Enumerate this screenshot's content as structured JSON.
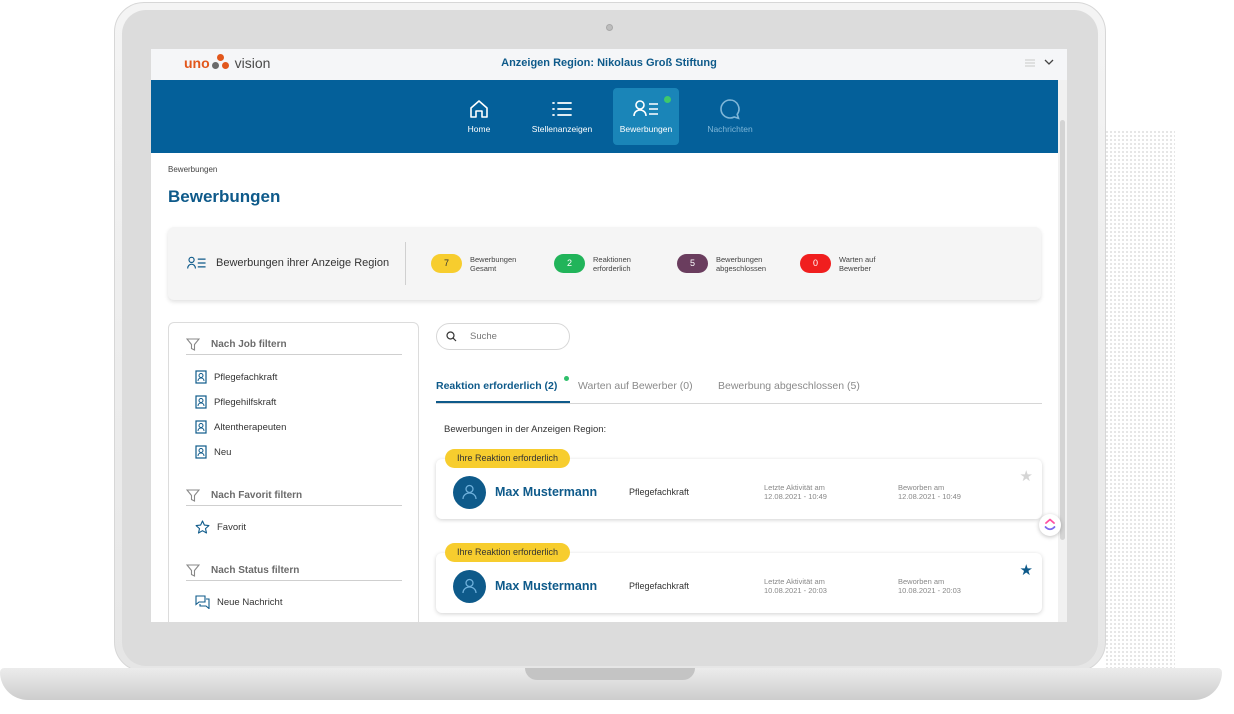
{
  "logo": {
    "part1": "uno",
    "part2": "vision"
  },
  "app_title": "Anzeigen Region: Nikolaus Groß Stiftung",
  "nav": {
    "home": "Home",
    "stellenanzeigen": "Stellenanzeigen",
    "bewerbungen": "Bewerbungen",
    "nachrichten": "Nachrichten"
  },
  "breadcrumb": "Bewerbungen",
  "page_title": "Bewerbungen",
  "stats": {
    "label": "Bewerbungen ihrer Anzeige Region",
    "items": [
      {
        "count": "7",
        "line1": "Bewerbungen",
        "line2": "Gesamt",
        "color": "#f7cd2e"
      },
      {
        "count": "2",
        "line1": "Reaktionen",
        "line2": "erforderlich",
        "color": "#21b45a"
      },
      {
        "count": "5",
        "line1": "Bewerbungen",
        "line2": "abgeschlossen",
        "color": "#6a3d5e"
      },
      {
        "count": "0",
        "line1": "Warten auf",
        "line2": "Bewerber",
        "color": "#f01e1e"
      }
    ]
  },
  "filters": {
    "job_heading": "Nach Job filtern",
    "jobs": [
      "Pflegefachkraft",
      "Pflegehilfskraft",
      "Altentherapeuten",
      "Neu"
    ],
    "favorit_heading": "Nach Favorit filtern",
    "favorit_item": "Favorit",
    "status_heading": "Nach Status filtern",
    "status_item": "Neue Nachricht"
  },
  "search": {
    "placeholder": "Suche"
  },
  "tabs": {
    "active": "Reaktion erforderlich (2)",
    "waiting": "Warten auf Bewerber (0)",
    "done": "Bewerbung abgeschlossen (5)"
  },
  "list_caption": "Bewerbungen in der Anzeigen Region:",
  "applications": [
    {
      "tag": "Ihre Reaktion erforderlich",
      "name": "Max Mustermann",
      "job": "Pflegefachkraft",
      "activity_label": "Letzte Aktivität am",
      "activity_date": "12.08.2021 - 10:49",
      "applied_label": "Beworben am",
      "applied_date": "12.08.2021 - 10:49",
      "favorite": false
    },
    {
      "tag": "Ihre Reaktion erforderlich",
      "name": "Max Mustermann",
      "job": "Pflegefachkraft",
      "activity_label": "Letzte Aktivität am",
      "activity_date": "10.08.2021 - 20:03",
      "applied_label": "Beworben am",
      "applied_date": "10.08.2021 - 20:03",
      "favorite": true
    }
  ],
  "colors": {
    "brand": "#04609a",
    "accent": "#0e5a8a",
    "tag": "#f7cd2e"
  }
}
